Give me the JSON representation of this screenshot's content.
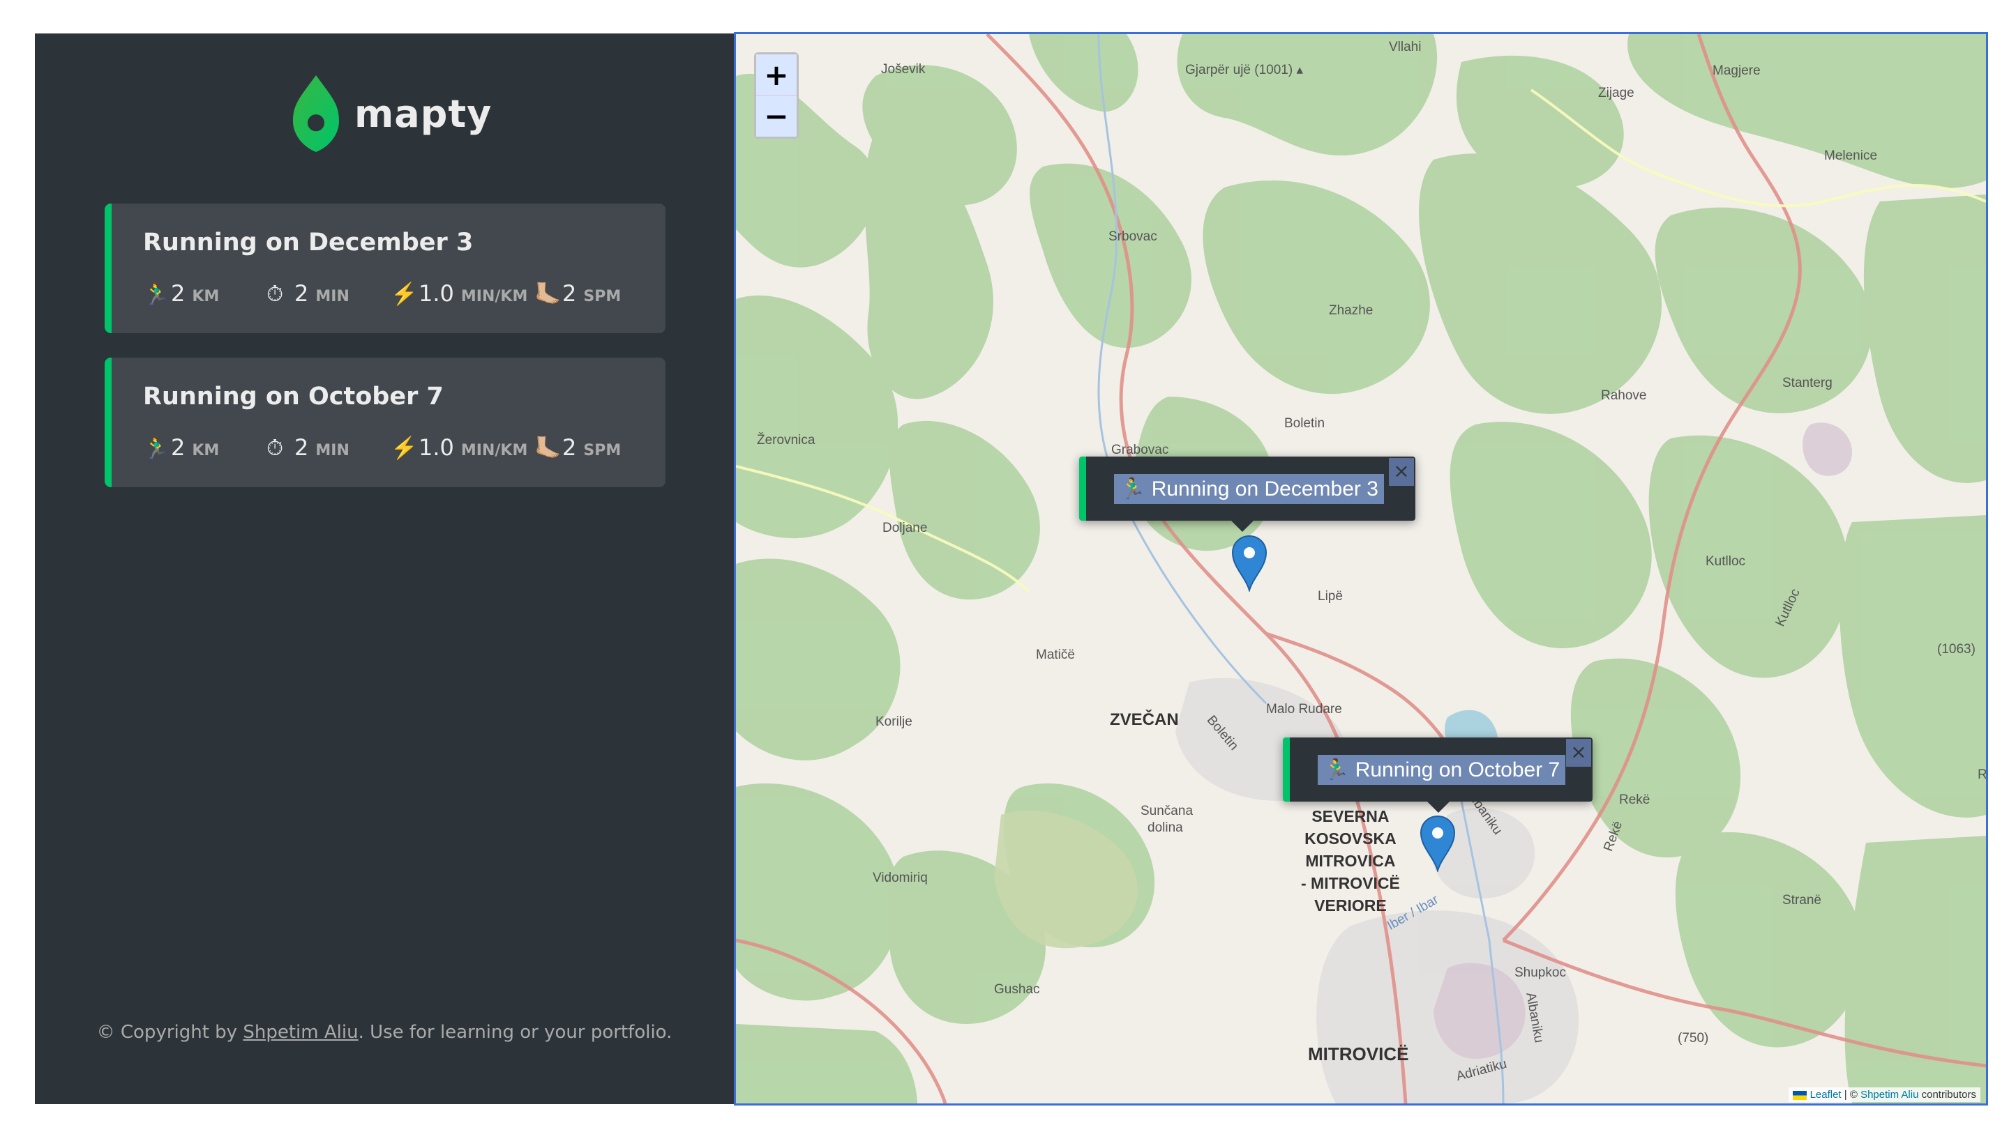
{
  "brand": {
    "name": "mapty",
    "accent": "#00c46a"
  },
  "workouts": [
    {
      "title": "Running on December 3",
      "distance": {
        "icon": "🏃‍♂️",
        "value": "2",
        "unit": "km"
      },
      "duration": {
        "icon": "⏱",
        "value": "2",
        "unit": "min"
      },
      "pace": {
        "icon": "⚡️",
        "value": "1.0",
        "unit": "min/km"
      },
      "cadence": {
        "icon": "🦶🏼",
        "value": "2",
        "unit": "spm"
      }
    },
    {
      "title": "Running on October 7",
      "distance": {
        "icon": "🏃‍♂️",
        "value": "2",
        "unit": "km"
      },
      "duration": {
        "icon": "⏱",
        "value": "2",
        "unit": "min"
      },
      "pace": {
        "icon": "⚡️",
        "value": "1.0",
        "unit": "min/km"
      },
      "cadence": {
        "icon": "🦶🏼",
        "value": "2",
        "unit": "spm"
      }
    }
  ],
  "copyright": {
    "prefix": "© Copyright by ",
    "author": "Shpetim Aliu",
    "suffix": ". Use for learning or your portfolio."
  },
  "map": {
    "zoom_in": "+",
    "zoom_out": "−",
    "popups": [
      "🏃‍♂️ Running on December 3",
      "🏃‍♂️ Running on October 7"
    ],
    "popup_close": "×",
    "attribution": {
      "leaflet": "Leaflet",
      "sep": " | © ",
      "author": "Shpetim Aliu",
      "suffix": " contributors"
    },
    "labels": {
      "josevik": "Joševik",
      "gjarper": "Gjarpër ujë (1001) ▴",
      "vllahi": "Vllahi",
      "magjere": "Magjere",
      "zijage": "Zijage",
      "melenice": "Melenice",
      "srbovac": "Srbovac",
      "zhazhe": "Zhazhe",
      "stanterg": "Stanterg",
      "rahove": "Rahove",
      "boletin": "Boletin",
      "zerovnica": "Žerovnica",
      "grabovac": "Grabovac",
      "doljane": "Doljane",
      "lipe": "Lipë",
      "kutlloc": "Kutlloc",
      "kutlloc2": "Kutlloc",
      "matice": "Matičë",
      "zvecan": "ZVEČAN",
      "malo_rudare": "Malo Rudare",
      "korilje": "Korilje",
      "boletin_river": "Boletin",
      "suncana": "Sunčana",
      "dolina": "dolina",
      "reke": "Rekë",
      "reke2": "Rekë",
      "severna1": "SEVERNA",
      "severna2": "KOSOVSKA",
      "severna3": "MITROVICA",
      "severna4": "- MITROVICË",
      "severna5": "VERIORE",
      "vidomiriq": "Vidomiriq",
      "iber": "Iber / Ibar",
      "albaniku": "Albaniku",
      "gushac": "Gushac",
      "shupkoc": "Shupkoc",
      "strane": "Stranë",
      "alt750": "(750)",
      "alt1063": "(1063)",
      "mitrovice": "MITROVICË",
      "adriatiku": "Adriatiku",
      "albaniku2": "Albaniku",
      "ras": "Ras"
    }
  }
}
